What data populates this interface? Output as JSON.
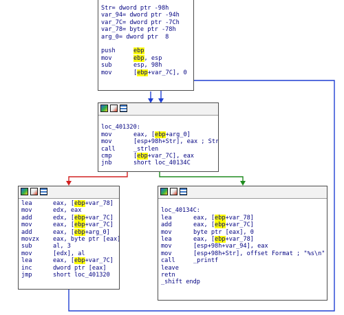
{
  "app": "IDA graph view",
  "colors": {
    "true_edge": "#1e8c1e",
    "false_edge": "#d22020",
    "jump_edge": "#1f3fd2",
    "text": "#000080",
    "highlight": "#ffff00"
  },
  "icons": [
    "graph-color-icon",
    "graph-edit-icon",
    "graph-list-icon"
  ],
  "top_block": {
    "decls": [
      "Str= dword ptr -98h",
      "var_94= dword ptr -94h",
      "var_7C= dword ptr -7Ch",
      "var_78= byte ptr -78h",
      "arg_0= dword ptr  8"
    ],
    "instrs": [
      {
        "m": "push",
        "a": "",
        "h": "ebp",
        "b": ""
      },
      {
        "m": "mov",
        "a": "",
        "h": "ebp",
        "b": ", esp"
      },
      {
        "m": "sub",
        "a": "esp, 98h",
        "h": "",
        "b": ""
      },
      {
        "m": "mov",
        "a": "[",
        "h": "ebp",
        "b": "+var_7C], 0"
      }
    ]
  },
  "loop_block": {
    "label": "loc_401320:",
    "instrs": [
      {
        "m": "mov",
        "a": "eax, [",
        "h": "ebp",
        "b": "+arg_0]"
      },
      {
        "m": "mov",
        "a": "[esp+98h+Str], eax ; Str",
        "h": "",
        "b": ""
      },
      {
        "m": "call",
        "a": "_strlen",
        "h": "",
        "b": ""
      },
      {
        "m": "cmp",
        "a": "[",
        "h": "ebp",
        "b": "+var_7C], eax"
      },
      {
        "m": "jnb",
        "a": "short loc_40134C",
        "h": "",
        "b": ""
      }
    ]
  },
  "body_block": {
    "instrs": [
      {
        "m": "lea",
        "a": "eax, [",
        "h": "ebp",
        "b": "+var_78]"
      },
      {
        "m": "mov",
        "a": "edx, eax",
        "h": "",
        "b": ""
      },
      {
        "m": "add",
        "a": "edx, [",
        "h": "ebp",
        "b": "+var_7C]"
      },
      {
        "m": "mov",
        "a": "eax, [",
        "h": "ebp",
        "b": "+var_7C]"
      },
      {
        "m": "add",
        "a": "eax, [",
        "h": "ebp",
        "b": "+arg_0]"
      },
      {
        "m": "movzx",
        "a": "eax, byte ptr [eax]",
        "h": "",
        "b": ""
      },
      {
        "m": "sub",
        "a": "al, 3",
        "h": "",
        "b": ""
      },
      {
        "m": "mov",
        "a": "[edx], al",
        "h": "",
        "b": ""
      },
      {
        "m": "lea",
        "a": "eax, [",
        "h": "ebp",
        "b": "+var_7C]"
      },
      {
        "m": "inc",
        "a": "dword ptr [eax]",
        "h": "",
        "b": ""
      },
      {
        "m": "jmp",
        "a": "short loc_401320",
        "h": "",
        "b": ""
      }
    ]
  },
  "exit_block": {
    "label": "loc_40134C:",
    "instrs": [
      {
        "m": "lea",
        "a": "eax, [",
        "h": "ebp",
        "b": "+var_78]"
      },
      {
        "m": "add",
        "a": "eax, [",
        "h": "ebp",
        "b": "+var_7C]"
      },
      {
        "m": "mov",
        "a": "byte ptr [eax], 0",
        "h": "",
        "b": ""
      },
      {
        "m": "lea",
        "a": "eax, [",
        "h": "ebp",
        "b": "+var_78]"
      },
      {
        "m": "mov",
        "a": "[esp+98h+var_94], eax",
        "h": "",
        "b": ""
      },
      {
        "m": "mov",
        "a": "[esp+98h+Str], offset Format ; \"%s\\n\"",
        "h": "",
        "b": ""
      },
      {
        "m": "call",
        "a": "_printf",
        "h": "",
        "b": ""
      },
      {
        "m": "leave",
        "a": "",
        "h": "",
        "b": ""
      },
      {
        "m": "retn",
        "a": "",
        "h": "",
        "b": ""
      }
    ],
    "endp": "_shift endp"
  }
}
